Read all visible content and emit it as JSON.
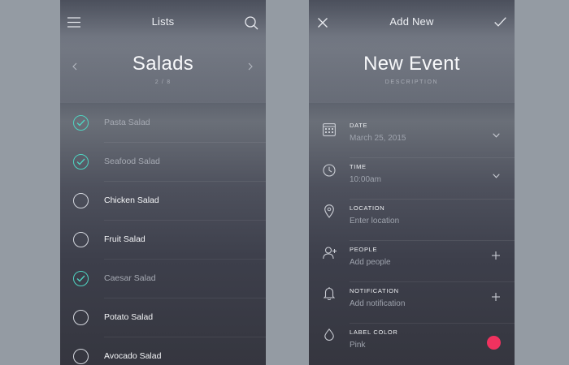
{
  "colors": {
    "accent_check": "#4fd4c2",
    "label_color_dot": "#f0325f"
  },
  "lists_screen": {
    "nav_title": "Lists",
    "title": "Salads",
    "pager": "2 / 8",
    "items": [
      {
        "label": "Pasta Salad",
        "checked": true
      },
      {
        "label": "Seafood Salad",
        "checked": true
      },
      {
        "label": "Chicken Salad",
        "checked": false
      },
      {
        "label": "Fruit Salad",
        "checked": false
      },
      {
        "label": "Caesar Salad",
        "checked": true
      },
      {
        "label": "Potato Salad",
        "checked": false
      },
      {
        "label": "Avocado Salad",
        "checked": false
      }
    ]
  },
  "add_screen": {
    "nav_title": "Add New",
    "title": "New Event",
    "subtitle": "DESCRIPTION",
    "fields": [
      {
        "label": "DATE",
        "value": "March 25, 2015",
        "icon": "calendar-icon",
        "action": "chevron-down-icon"
      },
      {
        "label": "TIME",
        "value": "10:00am",
        "icon": "clock-icon",
        "action": "chevron-down-icon"
      },
      {
        "label": "LOCATION",
        "value": "Enter location",
        "icon": "location-pin-icon",
        "action": ""
      },
      {
        "label": "PEOPLE",
        "value": "Add people",
        "icon": "add-person-icon",
        "action": "plus-icon"
      },
      {
        "label": "NOTIFICATION",
        "value": "Add notification",
        "icon": "bell-icon",
        "action": "plus-icon"
      },
      {
        "label": "LABEL COLOR",
        "value": "Pink",
        "icon": "drop-icon",
        "action": "color-dot"
      }
    ]
  }
}
